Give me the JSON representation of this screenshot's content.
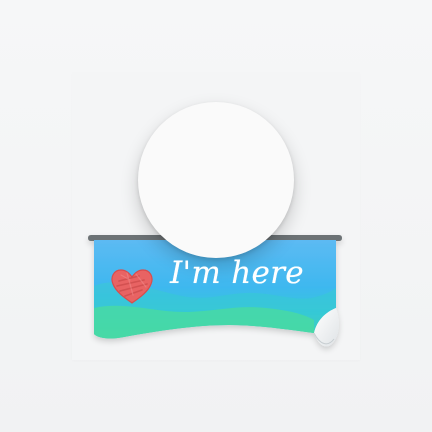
{
  "sticker": {
    "label": "I'm here",
    "heart_icon": "heart-icon",
    "avatar": "avatar-placeholder",
    "colors": {
      "banner_blue": "#4fb7f0",
      "banner_cyan": "#35c6dd",
      "banner_green": "#41d79a",
      "heart": "#e86363",
      "avatar_fill": "#fafafa",
      "card_background": "#f4f5f6"
    }
  }
}
